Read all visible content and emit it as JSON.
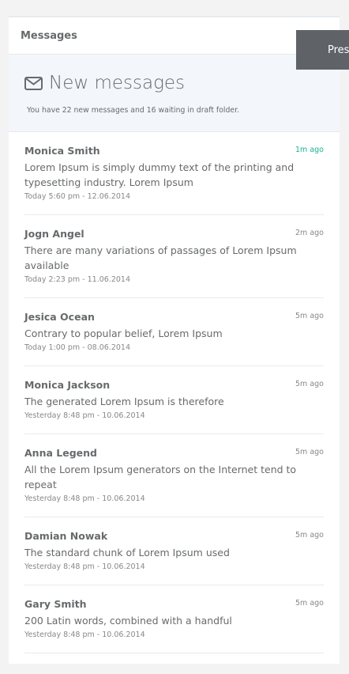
{
  "panel": {
    "title": "Messages",
    "tools": {
      "collapse_icon": "chevron-up-icon",
      "close_icon": "close-icon"
    }
  },
  "hero": {
    "icon": "envelope-icon",
    "title": "New messages",
    "subtitle": "You have 22 new messages and 16 waiting in draft folder."
  },
  "messages": [
    {
      "name": "Monica Smith",
      "text": "Lorem Ipsum is simply dummy text of the printing and typesetting industry. Lorem Ipsum",
      "date": "Today 5:60 pm - 12.06.2014",
      "ago": "1m ago",
      "is_new": true
    },
    {
      "name": "Jogn Angel",
      "text": "There are many variations of passages of Lorem Ipsum available",
      "date": "Today 2:23 pm - 11.06.2014",
      "ago": "2m ago",
      "is_new": false
    },
    {
      "name": "Jesica Ocean",
      "text": "Contrary to popular belief, Lorem Ipsum",
      "date": "Today 1:00 pm - 08.06.2014",
      "ago": "5m ago",
      "is_new": false
    },
    {
      "name": "Monica Jackson",
      "text": "The generated Lorem Ipsum is therefore",
      "date": "Yesterday 8:48 pm - 10.06.2014",
      "ago": "5m ago",
      "is_new": false
    },
    {
      "name": "Anna Legend",
      "text": "All the Lorem Ipsum generators on the Internet tend to repeat",
      "date": "Yesterday 8:48 pm - 10.06.2014",
      "ago": "5m ago",
      "is_new": false
    },
    {
      "name": "Damian Nowak",
      "text": "The standard chunk of Lorem Ipsum used",
      "date": "Yesterday 8:48 pm - 10.06.2014",
      "ago": "5m ago",
      "is_new": false
    },
    {
      "name": "Gary Smith",
      "text": "200 Latin words, combined with a handful",
      "date": "Yesterday 8:48 pm - 10.06.2014",
      "ago": "5m ago",
      "is_new": false
    }
  ],
  "overlay": {
    "label": "Pres"
  },
  "colors": {
    "accent": "#1ab394",
    "hero_bg": "#f3f6fb",
    "overlay_bg": "#5f6368"
  }
}
